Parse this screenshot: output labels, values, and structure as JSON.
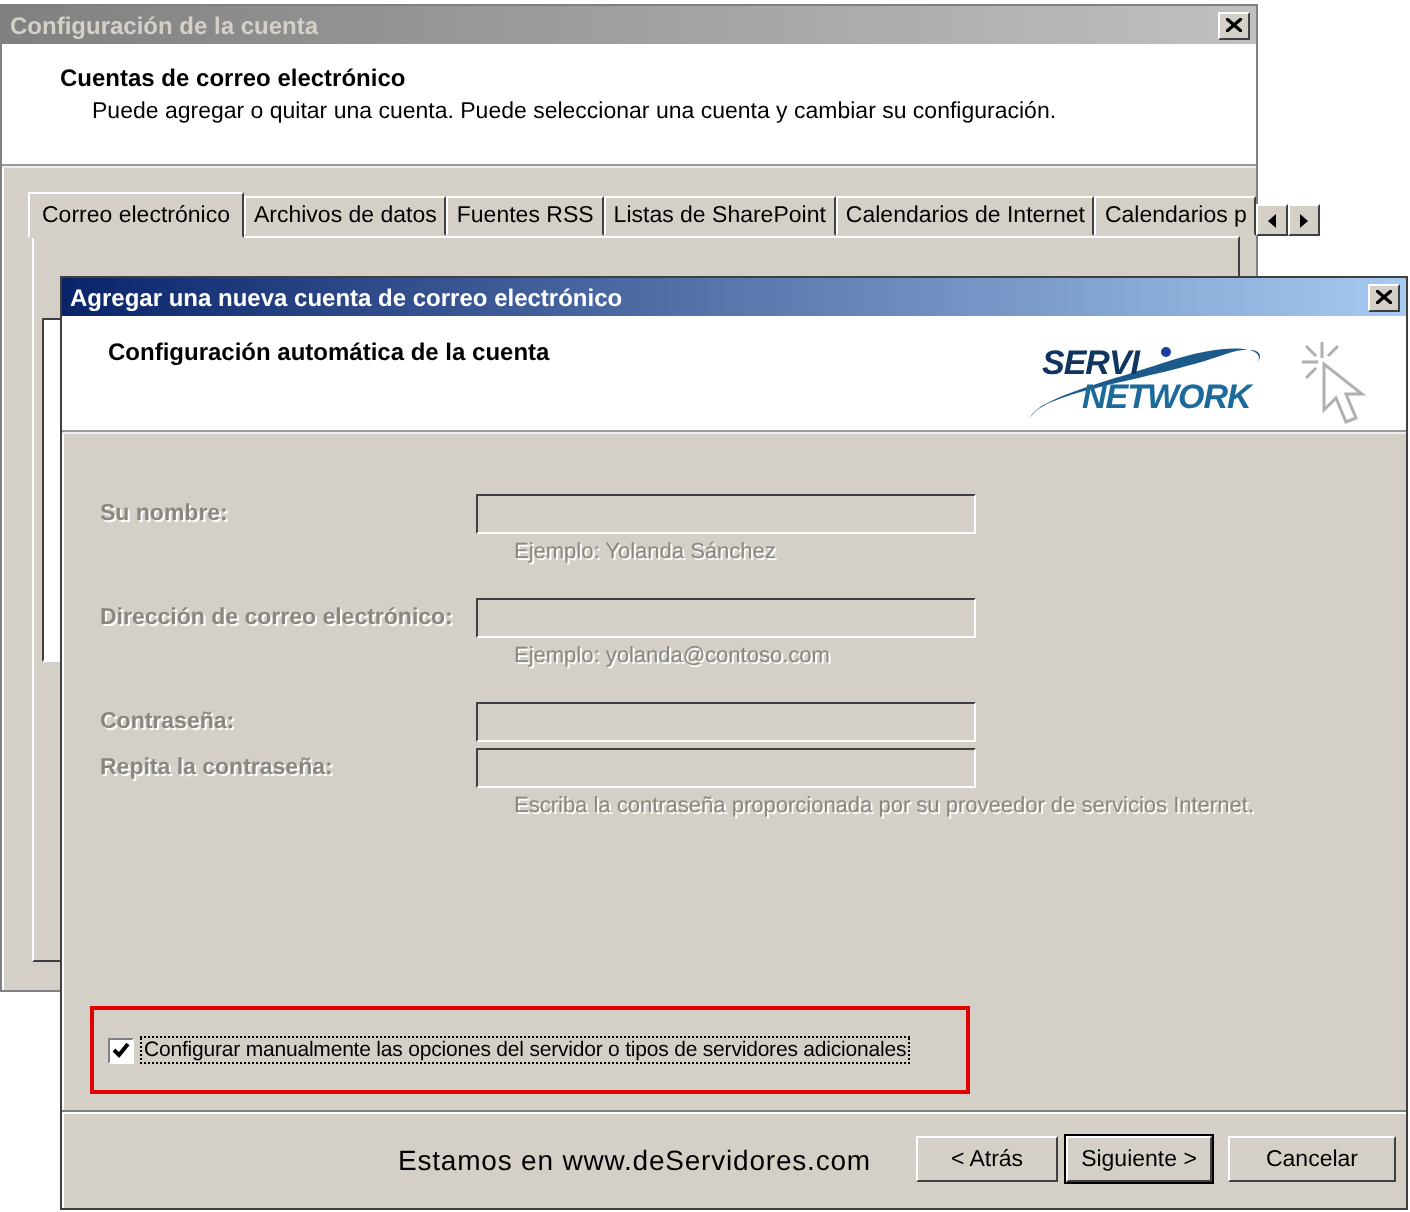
{
  "back_window": {
    "title": "Configuración de la cuenta",
    "heading": "Cuentas de correo electrónico",
    "description": "Puede agregar o quitar una cuenta. Puede seleccionar una cuenta y cambiar su configuración.",
    "tabs": [
      {
        "label": "Correo electrónico",
        "selected": true
      },
      {
        "label": "Archivos de datos",
        "selected": false
      },
      {
        "label": "Fuentes RSS",
        "selected": false
      },
      {
        "label": "Listas de SharePoint",
        "selected": false
      },
      {
        "label": "Calendarios de Internet",
        "selected": false
      },
      {
        "label": "Calendarios p",
        "selected": false
      }
    ]
  },
  "dialog": {
    "title": "Agregar una nueva cuenta de correo electrónico",
    "heading": "Configuración automática de la cuenta",
    "logo": {
      "line1": "SERVI",
      "line2": "NETWORK"
    },
    "fields": [
      {
        "label": "Su nombre:",
        "hint": "Ejemplo: Yolanda Sánchez",
        "disabled": true
      },
      {
        "label": "Dirección de correo electrónico:",
        "hint": "Ejemplo: yolanda@contoso.com",
        "disabled": true
      },
      {
        "label": "Contraseña:",
        "disabled": true
      },
      {
        "label": "Repita la contraseña:",
        "hint": "Escriba la contraseña proporcionada por su proveedor de servicios Internet.",
        "disabled": true
      }
    ],
    "manual_config": {
      "label": "Configurar manualmente las opciones del servidor o tipos de servidores adicionales",
      "checked": true
    },
    "footer_note": "Estamos en www.deServidores.com",
    "buttons": [
      {
        "label": "< Atrás",
        "default": false
      },
      {
        "label": "Siguiente >",
        "default": true
      },
      {
        "label": "Cancelar",
        "default": false
      }
    ]
  }
}
